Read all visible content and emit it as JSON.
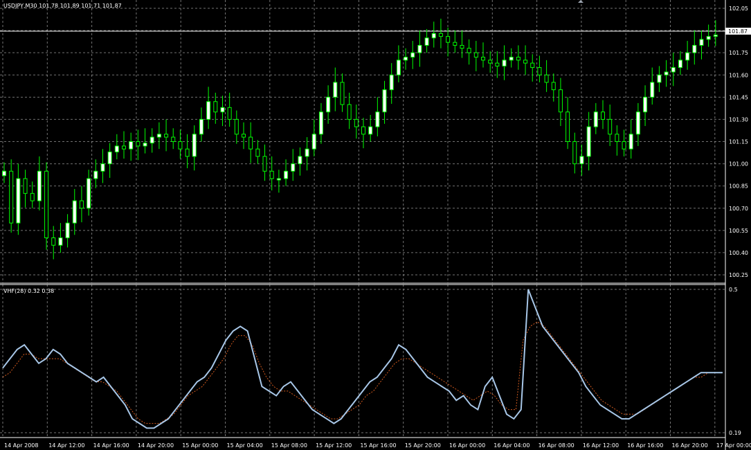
{
  "main": {
    "header": "USDJPY,M30  101.78 101.89 101.71 101.87",
    "price_axis": [
      "102.05",
      "101.90",
      "101.75",
      "101.60",
      "101.45",
      "101.30",
      "101.15",
      "101.00",
      "100.85",
      "100.70",
      "100.55",
      "100.40",
      "100.25"
    ],
    "current_price": "101.87",
    "colors": {
      "background": "#000000",
      "grid": "#c0c0c0",
      "axis": "#ffffff",
      "bull_candle": "#ffffff",
      "bear_candle": "#000000",
      "wick": "#00ff00",
      "price_box": "#ffffff"
    }
  },
  "indicator": {
    "label": "VHF(28) 0.32 0.38",
    "axis_top": "0.5",
    "axis_bottom": "0.19",
    "colors": {
      "vhf_line": "#a8c7e8",
      "signal_line": "#d25a1e"
    }
  },
  "time_axis": [
    "14 Apr 2008",
    "14 Apr 12:00",
    "14 Apr 16:00",
    "14 Apr 20:00",
    "15 Apr 00:00",
    "15 Apr 04:00",
    "15 Apr 08:00",
    "15 Apr 12:00",
    "15 Apr 16:00",
    "15 Apr 20:00",
    "16 Apr 00:00",
    "16 Apr 04:00",
    "16 Apr 08:00",
    "16 Apr 12:00",
    "16 Apr 16:00",
    "16 Apr 20:00",
    "17 Apr 00:00"
  ],
  "chart_data": [
    {
      "type": "candlestick",
      "title": "USDJPY,M30  101.78 101.89 101.71 101.87",
      "ylim": [
        100.25,
        102.05
      ],
      "grid": true,
      "ticks": [
        "102.05",
        "101.90",
        "101.75",
        "101.60",
        "101.45",
        "101.30",
        "101.15",
        "101.00",
        "100.85",
        "100.70",
        "100.55",
        "100.40",
        "100.25"
      ],
      "close_series": [
        100.95,
        100.6,
        100.9,
        100.8,
        100.75,
        100.95,
        100.5,
        100.45,
        100.5,
        100.6,
        100.75,
        100.7,
        100.9,
        100.95,
        101.0,
        101.08,
        101.12,
        101.1,
        101.15,
        101.12,
        101.14,
        101.18,
        101.2,
        101.18,
        101.15,
        101.1,
        101.05,
        101.2,
        101.3,
        101.42,
        101.35,
        101.38,
        101.3,
        101.2,
        101.18,
        101.1,
        101.05,
        100.95,
        100.9,
        100.9,
        100.95,
        101.0,
        101.05,
        101.1,
        101.2,
        101.35,
        101.45,
        101.55,
        101.4,
        101.3,
        101.25,
        101.2,
        101.25,
        101.35,
        101.5,
        101.6,
        101.7,
        101.72,
        101.75,
        101.8,
        101.85,
        101.88,
        101.86,
        101.82,
        101.8,
        101.78,
        101.75,
        101.72,
        101.7,
        101.68,
        101.66,
        101.7,
        101.72,
        101.7,
        101.68,
        101.65,
        101.6,
        101.55,
        101.5,
        101.35,
        101.15,
        101.0,
        101.05,
        101.25,
        101.35,
        101.3,
        101.2,
        101.15,
        101.1,
        101.2,
        101.35,
        101.45,
        101.55,
        101.6,
        101.62,
        101.65,
        101.7,
        101.75,
        101.8,
        101.84,
        101.86,
        101.87
      ],
      "last": 101.87
    },
    {
      "type": "line",
      "title": "VHF(28) 0.32 0.38",
      "ylim": [
        0.19,
        0.5
      ],
      "grid": true,
      "ticks": [
        "0.5",
        "0.19"
      ],
      "series": [
        {
          "name": "VHF(28)",
          "values": [
            0.33,
            0.35,
            0.37,
            0.38,
            0.36,
            0.34,
            0.35,
            0.37,
            0.36,
            0.34,
            0.33,
            0.32,
            0.31,
            0.3,
            0.31,
            0.29,
            0.27,
            0.25,
            0.22,
            0.21,
            0.2,
            0.2,
            0.21,
            0.22,
            0.24,
            0.26,
            0.28,
            0.3,
            0.31,
            0.33,
            0.36,
            0.39,
            0.41,
            0.42,
            0.41,
            0.35,
            0.29,
            0.28,
            0.27,
            0.29,
            0.3,
            0.28,
            0.26,
            0.24,
            0.23,
            0.22,
            0.21,
            0.22,
            0.24,
            0.26,
            0.28,
            0.3,
            0.31,
            0.33,
            0.35,
            0.38,
            0.37,
            0.35,
            0.33,
            0.31,
            0.3,
            0.29,
            0.28,
            0.26,
            0.27,
            0.25,
            0.24,
            0.29,
            0.31,
            0.27,
            0.23,
            0.22,
            0.24,
            0.5,
            0.46,
            0.42,
            0.4,
            0.38,
            0.36,
            0.34,
            0.32,
            0.29,
            0.27,
            0.25,
            0.24,
            0.23,
            0.22,
            0.22,
            0.23,
            0.24,
            0.25,
            0.26,
            0.27,
            0.28,
            0.29,
            0.3,
            0.31,
            0.32,
            0.32,
            0.32,
            0.32
          ]
        },
        {
          "name": "signal",
          "values": [
            0.31,
            0.32,
            0.34,
            0.36,
            0.36,
            0.35,
            0.35,
            0.35,
            0.35,
            0.34,
            0.33,
            0.32,
            0.31,
            0.3,
            0.3,
            0.29,
            0.28,
            0.26,
            0.24,
            0.22,
            0.21,
            0.21,
            0.21,
            0.22,
            0.23,
            0.25,
            0.27,
            0.28,
            0.29,
            0.31,
            0.33,
            0.35,
            0.38,
            0.4,
            0.4,
            0.38,
            0.34,
            0.31,
            0.29,
            0.28,
            0.28,
            0.27,
            0.26,
            0.25,
            0.24,
            0.23,
            0.22,
            0.22,
            0.23,
            0.24,
            0.25,
            0.27,
            0.28,
            0.3,
            0.32,
            0.34,
            0.35,
            0.35,
            0.34,
            0.33,
            0.32,
            0.31,
            0.3,
            0.29,
            0.28,
            0.27,
            0.26,
            0.27,
            0.28,
            0.27,
            0.25,
            0.24,
            0.24,
            0.39,
            0.42,
            0.43,
            0.42,
            0.4,
            0.38,
            0.36,
            0.34,
            0.32,
            0.3,
            0.28,
            0.26,
            0.25,
            0.24,
            0.23,
            0.23,
            0.23,
            0.24,
            0.25,
            0.26,
            0.27,
            0.28,
            0.29,
            0.3,
            0.31,
            0.31,
            0.32,
            0.32,
            0.32
          ]
        }
      ]
    }
  ]
}
